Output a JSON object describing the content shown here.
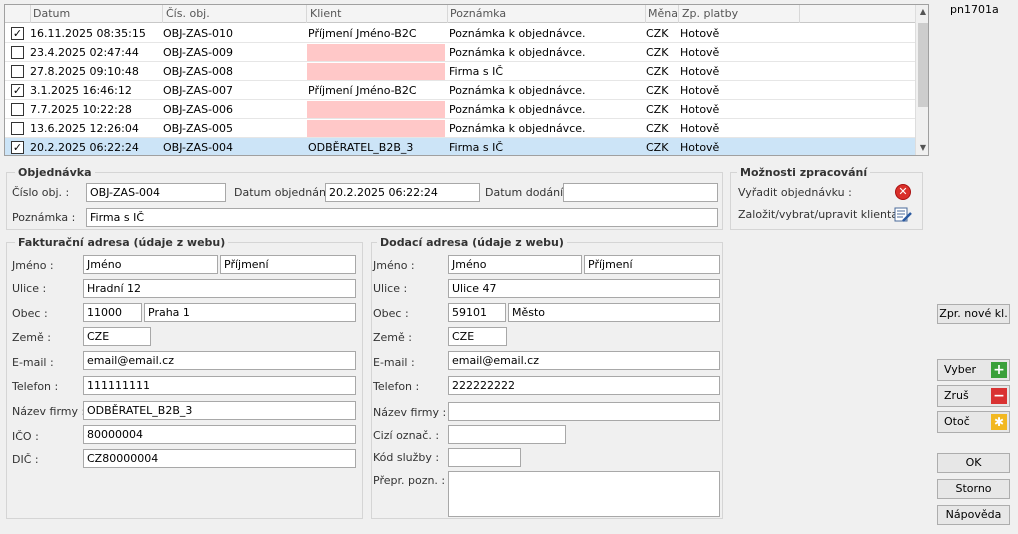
{
  "grid": {
    "columns": [
      "Datum",
      "Čís. obj.",
      "Klient",
      "Poznámka",
      "Měna",
      "Zp. platby"
    ],
    "rows": [
      {
        "checked": true,
        "datum": "16.11.2025 08:35:15",
        "cislo": "OBJ-ZAS-010",
        "klient": "Příjmení Jméno-B2C",
        "pozn": "Poznámka k objednávce.",
        "mena": "CZK",
        "platba": "Hotově",
        "pink": false,
        "selected": false
      },
      {
        "checked": false,
        "datum": "23.4.2025 02:47:44",
        "cislo": "OBJ-ZAS-009",
        "klient": "",
        "pozn": "Poznámka k objednávce.",
        "mena": "CZK",
        "platba": "Hotově",
        "pink": true,
        "selected": false
      },
      {
        "checked": false,
        "datum": "27.8.2025 09:10:48",
        "cislo": "OBJ-ZAS-008",
        "klient": "",
        "pozn": "Firma s IČ",
        "mena": "CZK",
        "platba": "Hotově",
        "pink": true,
        "selected": false
      },
      {
        "checked": true,
        "datum": "3.1.2025 16:46:12",
        "cislo": "OBJ-ZAS-007",
        "klient": "Příjmení Jméno-B2C",
        "pozn": "Poznámka k objednávce.",
        "mena": "CZK",
        "platba": "Hotově",
        "pink": false,
        "selected": false
      },
      {
        "checked": false,
        "datum": "7.7.2025 10:22:28",
        "cislo": "OBJ-ZAS-006",
        "klient": "",
        "pozn": "Poznámka k objednávce.",
        "mena": "CZK",
        "platba": "Hotově",
        "pink": true,
        "selected": false
      },
      {
        "checked": false,
        "datum": "13.6.2025 12:26:04",
        "cislo": "OBJ-ZAS-005",
        "klient": "",
        "pozn": "Poznámka k objednávce.",
        "mena": "CZK",
        "platba": "Hotově",
        "pink": true,
        "selected": false
      },
      {
        "checked": true,
        "datum": "20.2.2025 06:22:24",
        "cislo": "OBJ-ZAS-004",
        "klient": "ODBĚRATEL_B2B_3",
        "pozn": "Firma s IČ",
        "mena": "CZK",
        "platba": "Hotově",
        "pink": false,
        "selected": true
      }
    ]
  },
  "version": "pn1701a",
  "order": {
    "title": "Objednávka",
    "cislo_label": "Číslo obj. :",
    "cislo": "OBJ-ZAS-004",
    "datum_obj_label": "Datum objednání :",
    "datum_obj": "20.2.2025 06:22:24",
    "datum_dod_label": "Datum dodání :",
    "datum_dod": "",
    "pozn_label": "Poznámka :",
    "pozn": "Firma s IČ"
  },
  "options": {
    "title": "Možnosti zpracování",
    "vyradit": "Vyřadit objednávku :",
    "zalozit": "Založit/vybrat/upravit klienta :"
  },
  "billing": {
    "title": "Fakturační adresa (údaje z webu)",
    "jmeno_label": "Jméno :",
    "jmeno": "Jméno",
    "prijmeni": "Příjmení",
    "ulice_label": "Ulice :",
    "ulice": "Hradní 12",
    "obec_label": "Obec :",
    "psc": "11000",
    "obec": "Praha 1",
    "zeme_label": "Země :",
    "zeme": "CZE",
    "email_label": "E-mail :",
    "email": "email@email.cz",
    "telefon_label": "Telefon :",
    "telefon": "111111111",
    "firma_label": "Název firmy :",
    "firma": "ODBĚRATEL_B2B_3",
    "ico_label": "IČO :",
    "ico": "80000004",
    "dic_label": "DIČ :",
    "dic": "CZ80000004"
  },
  "delivery": {
    "title": "Dodací adresa (údaje z webu)",
    "jmeno_label": "Jméno :",
    "jmeno": "Jméno",
    "prijmeni": "Příjmení",
    "ulice_label": "Ulice :",
    "ulice": "Ulice 47",
    "obec_label": "Obec :",
    "psc": "59101",
    "obec": "Město",
    "zeme_label": "Země :",
    "zeme": "CZE",
    "email_label": "E-mail :",
    "email": "email@email.cz",
    "telefon_label": "Telefon :",
    "telefon": "222222222",
    "firma_label": "Název firmy :",
    "firma": "",
    "cizi_label": "Cizí označ. :",
    "cizi": "",
    "kod_label": "Kód služby :",
    "kod": "",
    "prepr_label": "Přepr. pozn. :",
    "prepr": ""
  },
  "buttons": {
    "zpr": "Zpr. nové kl.",
    "vyber": "Vyber",
    "zrus": "Zruš",
    "otoc": "Otoč",
    "ok": "OK",
    "storno": "Storno",
    "napoveda": "Nápověda"
  }
}
